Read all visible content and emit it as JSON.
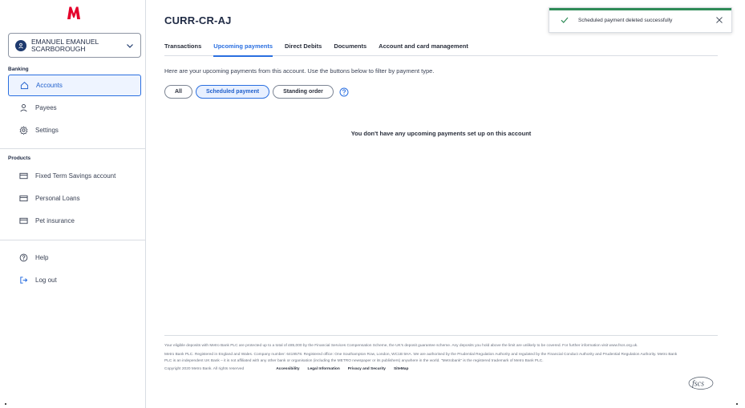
{
  "brand": {
    "logo_letter": "M",
    "accent": "#2a6fe0",
    "logo_color": "#e4002b"
  },
  "user": {
    "name": "EMANUEL EMANUEL SCARBOROUGH",
    "avatar_icon": "person-icon"
  },
  "sidebar": {
    "banking_label": "Banking",
    "banking_items": [
      {
        "label": "Accounts",
        "icon": "home-icon",
        "active": true
      },
      {
        "label": "Payees",
        "icon": "person-icon",
        "active": false
      },
      {
        "label": "Settings",
        "icon": "gear-icon",
        "active": false
      }
    ],
    "products_label": "Products",
    "product_items": [
      {
        "label": "Fixed Term Savings account",
        "icon": "card-icon"
      },
      {
        "label": "Personal Loans",
        "icon": "card-icon"
      },
      {
        "label": "Pet insurance",
        "icon": "card-icon"
      }
    ],
    "bottom_items": [
      {
        "label": "Help",
        "icon": "question-icon"
      },
      {
        "label": "Log out",
        "icon": "logout-icon"
      }
    ]
  },
  "page": {
    "title": "CURR-CR-AJ",
    "tabs": [
      {
        "label": "Transactions",
        "active": false
      },
      {
        "label": "Upcoming payments",
        "active": true
      },
      {
        "label": "Direct Debits",
        "active": false
      },
      {
        "label": "Documents",
        "active": false
      },
      {
        "label": "Account and card management",
        "active": false
      }
    ],
    "intro": "Here are your upcoming payments from this account. Use the buttons below to filter by payment type.",
    "filters": [
      {
        "label": "All",
        "selected": false
      },
      {
        "label": "Scheduled payment",
        "selected": true
      },
      {
        "label": "Standing order",
        "selected": false
      }
    ],
    "empty_message": "You don't have any upcoming payments set up on this account"
  },
  "toast": {
    "message": "Scheduled payment deleted successfully",
    "status_color": "#2e8b57"
  },
  "footer": {
    "fscs_text": "Your eligible deposits with Metro Bank PLC are protected up to a total of £85,000 by the Financial Services Compensation Scheme, the UK's deposit guarantee scheme. Any deposits you hold above the limit are unlikely to be covered. For further information visit www.fscs.org.uk.",
    "registration_text": "Metro Bank PLC. Registered in England and Wales. Company number: 6419578. Registered office: One Southampton Row, London, WC1B 5HA. We are authorised by the Prudential Regulation Authority and regulated by the Financial Conduct Authority and Prudential Regulation Authority. Metro Bank PLC is an independent UK Bank – it is not affiliated with any other bank or organisation (including the METRO newspaper or its publishers) anywhere in the world. \"Metrobank\" is the registered trademark of Metro Bank PLC.",
    "copyright": "Copyright 2020 Metro Bank. All rights reserved",
    "links": [
      "Accessibility",
      "Legal Information",
      "Privacy and Security",
      "SiteMap"
    ],
    "fscs_logo": "fscs"
  }
}
